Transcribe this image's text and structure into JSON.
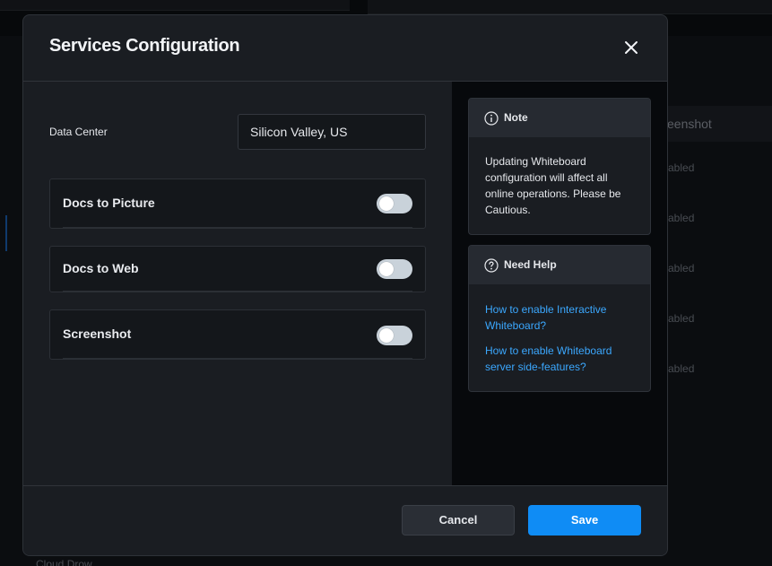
{
  "background": {
    "column_header": "eenshot",
    "cells": [
      "abled",
      "abled",
      "abled",
      "abled",
      "abled"
    ],
    "bottom_text": "Cloud Drow"
  },
  "modal": {
    "title": "Services Configuration",
    "close_icon": "close-icon",
    "data_center": {
      "label": "Data Center",
      "value": "Silicon Valley, US"
    },
    "services": [
      {
        "label": "Docs to Picture",
        "enabled": false
      },
      {
        "label": "Docs to Web",
        "enabled": false
      },
      {
        "label": "Screenshot",
        "enabled": false
      }
    ],
    "note": {
      "icon": "info-icon",
      "title": "Note",
      "text": "Updating Whiteboard configuration will affect all online operations. Please be Cautious."
    },
    "help": {
      "icon": "question-icon",
      "title": "Need Help",
      "links": [
        "How to enable Interactive Whiteboard?",
        "How to enable Whiteboard server side-features?"
      ]
    },
    "footer": {
      "cancel_label": "Cancel",
      "save_label": "Save"
    }
  },
  "colors": {
    "accent": "#0f8cf5",
    "link": "#3ba8ff",
    "modal_bg": "#1a1d22",
    "side_pane_bg": "#07090c"
  }
}
